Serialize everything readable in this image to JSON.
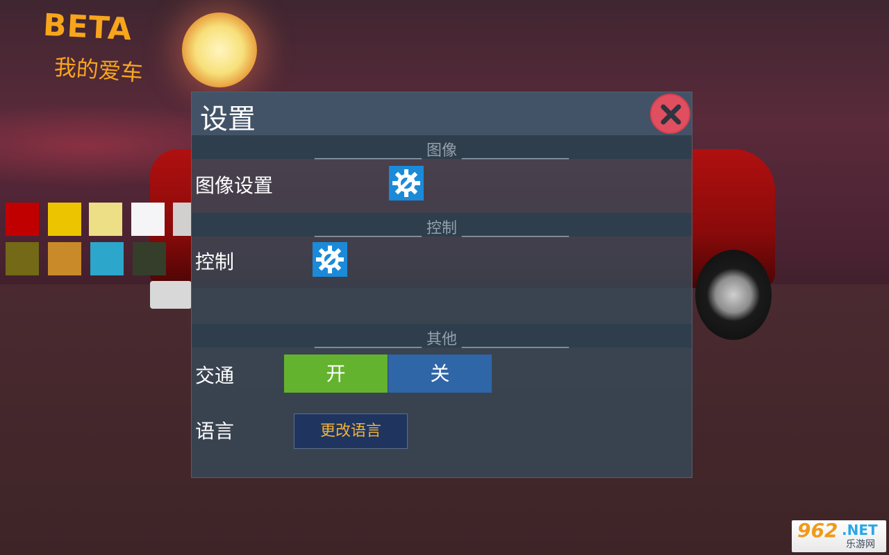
{
  "game": {
    "badge": "BETA",
    "subtitle": "我的爱车"
  },
  "swatches": [
    "#c00000",
    "#ecc500",
    "#ecdf86",
    "#f5f5f8",
    "#d2d0cf",
    "#736917",
    "#c98a2a",
    "#2da6cc",
    "#353d2b"
  ],
  "settings": {
    "title": "设置",
    "close_icon": "close-icon",
    "sections": {
      "graphics": "______________ 图像 ______________",
      "controls": "______________ 控制 ______________",
      "other": "______________ 其他 ______________"
    },
    "rows": {
      "graphics_settings_label": "图像设置",
      "controls_label": "控制",
      "traffic_label": "交通",
      "language_label": "语言"
    },
    "traffic": {
      "on": "开",
      "off": "关"
    },
    "language_button": "更改语言"
  },
  "watermark": {
    "number": "962",
    "domain": ".NET",
    "name": "乐游网"
  }
}
